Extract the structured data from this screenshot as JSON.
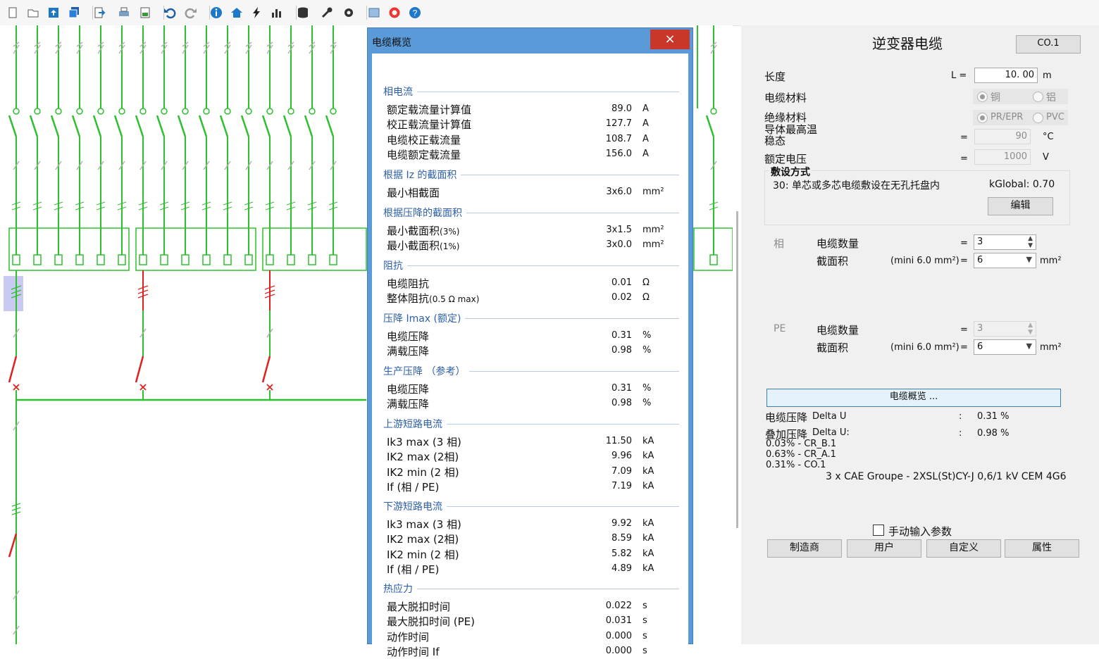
{
  "toolbar": {
    "icons": [
      "new-file-icon",
      "open-folder-icon",
      "upload-icon",
      "save-all-icon",
      "export-icon",
      "print-icon",
      "image-export-icon",
      "undo-icon",
      "redo-icon",
      "info-icon",
      "home-icon",
      "lightning-icon",
      "bar-chart-icon",
      "database-icon",
      "key-icon",
      "gear-icon",
      "grid-icon",
      "lifebuoy-icon",
      "help-icon"
    ]
  },
  "colors": {
    "accent": "#5a9ad8",
    "close": "#c9362a",
    "green": "#2fc02f",
    "red": "#e02020",
    "section": "#2c5fa8"
  },
  "dialog": {
    "title": "电缆概览",
    "close": "×",
    "sections": [
      {
        "title": "相电流",
        "rows": [
          {
            "label": "额定载流量计算值",
            "value": "89.0",
            "unit": "A"
          },
          {
            "label": "校正载流量计算值",
            "value": "127.7",
            "unit": "A"
          },
          {
            "label": "电缆校正载流量",
            "value": "108.7",
            "unit": "A"
          },
          {
            "label": "电缆额定载流量",
            "value": "156.0",
            "unit": "A"
          }
        ]
      },
      {
        "title": "根据 Iz 的截面积",
        "rows": [
          {
            "label": "最小相截面",
            "value": "3x6.0",
            "unit": "mm²"
          }
        ]
      },
      {
        "title": "根据压降的截面积",
        "rows": [
          {
            "label": "最小截面积",
            "small": "(3%)",
            "value": "3x1.5",
            "unit": "mm²"
          },
          {
            "label": "最小截面积",
            "small": "(1%)",
            "value": "3x0.0",
            "unit": "mm²"
          }
        ]
      },
      {
        "title": "阻抗",
        "rows": [
          {
            "label": "电缆阻抗",
            "value": "0.01",
            "unit": "Ω"
          },
          {
            "label": "整体阻抗",
            "small": "(0.5 Ω max)",
            "value": "0.02",
            "unit": "Ω"
          }
        ]
      },
      {
        "title": "压降 Imax (额定)",
        "rows": [
          {
            "label": "电缆压降",
            "value": "0.31",
            "unit": "%"
          },
          {
            "label": "满载压降",
            "value": "0.98",
            "unit": "%"
          }
        ]
      },
      {
        "title": "生产压降 （参考）",
        "rows": [
          {
            "label": "电缆压降",
            "value": "0.31",
            "unit": "%"
          },
          {
            "label": "满载压降",
            "value": "0.98",
            "unit": "%"
          }
        ]
      },
      {
        "title": "上游短路电流",
        "rows": [
          {
            "label": "Ik3 max (3 相)",
            "value": "11.50",
            "unit": "kA"
          },
          {
            "label": "IK2 max (2相)",
            "value": "9.96",
            "unit": "kA"
          },
          {
            "label": "IK2 min (2 相)",
            "value": "7.09",
            "unit": "kA"
          },
          {
            "label": "If (相 / PE)",
            "value": "7.19",
            "unit": "kA"
          }
        ]
      },
      {
        "title": "下游短路电流",
        "rows": [
          {
            "label": "Ik3 max (3 相)",
            "value": "9.92",
            "unit": "kA"
          },
          {
            "label": "IK2 max (2相)",
            "value": "8.59",
            "unit": "kA"
          },
          {
            "label": "IK2 min (2 相)",
            "value": "5.82",
            "unit": "kA"
          },
          {
            "label": "If (相 / PE)",
            "value": "4.89",
            "unit": "kA"
          }
        ]
      },
      {
        "title": "热应力",
        "rows": [
          {
            "label": "最大脱扣时间",
            "value": "0.022",
            "unit": "s"
          },
          {
            "label": "最大脱扣时间 (PE)",
            "value": "0.031",
            "unit": "s"
          },
          {
            "label": "动作时间",
            "value": "0.000",
            "unit": "s"
          },
          {
            "label": "动作时间 If",
            "value": "0.000",
            "unit": "s"
          }
        ]
      }
    ]
  },
  "panel": {
    "title": "逆变器电缆",
    "ref": "CO.1",
    "length": {
      "label": "长度",
      "symbol": "L =",
      "value": "10. 00",
      "unit": "m"
    },
    "material": {
      "label": "电缆材料",
      "opt1": "铜",
      "opt2": "铝"
    },
    "insulation": {
      "label": "绝缘材料",
      "opt1": "PR/EPR",
      "opt2": "PVC"
    },
    "maxtemp": {
      "label1": "导体最高温",
      "label2": "稳态",
      "eq": "=",
      "value": "90",
      "unit": "°C"
    },
    "voltage": {
      "label": "额定电压",
      "eq": "=",
      "value": "1000",
      "unit": "V"
    },
    "laying": {
      "title": "敷设方式",
      "method": "30: 单芯或多芯电缆敷设在无孔托盘内",
      "kglobal": "kGlobal: 0.70",
      "edit": "编辑"
    },
    "phase": {
      "tag": "相",
      "count_label": "电缆数量",
      "eq": "=",
      "count": "3",
      "area_label": "截面积",
      "mini": "(mini 6.0 mm²)",
      "area": "6",
      "unit": "mm²"
    },
    "pe": {
      "tag": "PE",
      "count_label": "电缆数量",
      "eq": "=",
      "count": "3",
      "area_label": "截面积",
      "mini": "(mini 6.0 mm²)",
      "area": "6",
      "unit": "mm²"
    },
    "overview_button": "电缆概览 ...",
    "drop": {
      "label": "电缆压降",
      "label_en": "Delta U",
      "colon": ":",
      "value": "0.31 %"
    },
    "cum": {
      "label": "叠加压降",
      "label_en": "Delta U:",
      "colon": ":",
      "value": "0.98 %"
    },
    "breakdown": [
      "0.03% - CR_B.1",
      "0.63% - CR_A.1",
      "0.31% - CO.1"
    ],
    "cable_desc": "3 x CAE Groupe - 2XSL(St)CY-J 0,6/1 kV CEM 4G6",
    "manual": "手动输入参数",
    "buttons": [
      "制造商",
      "用户",
      "自定义",
      "属性"
    ]
  }
}
